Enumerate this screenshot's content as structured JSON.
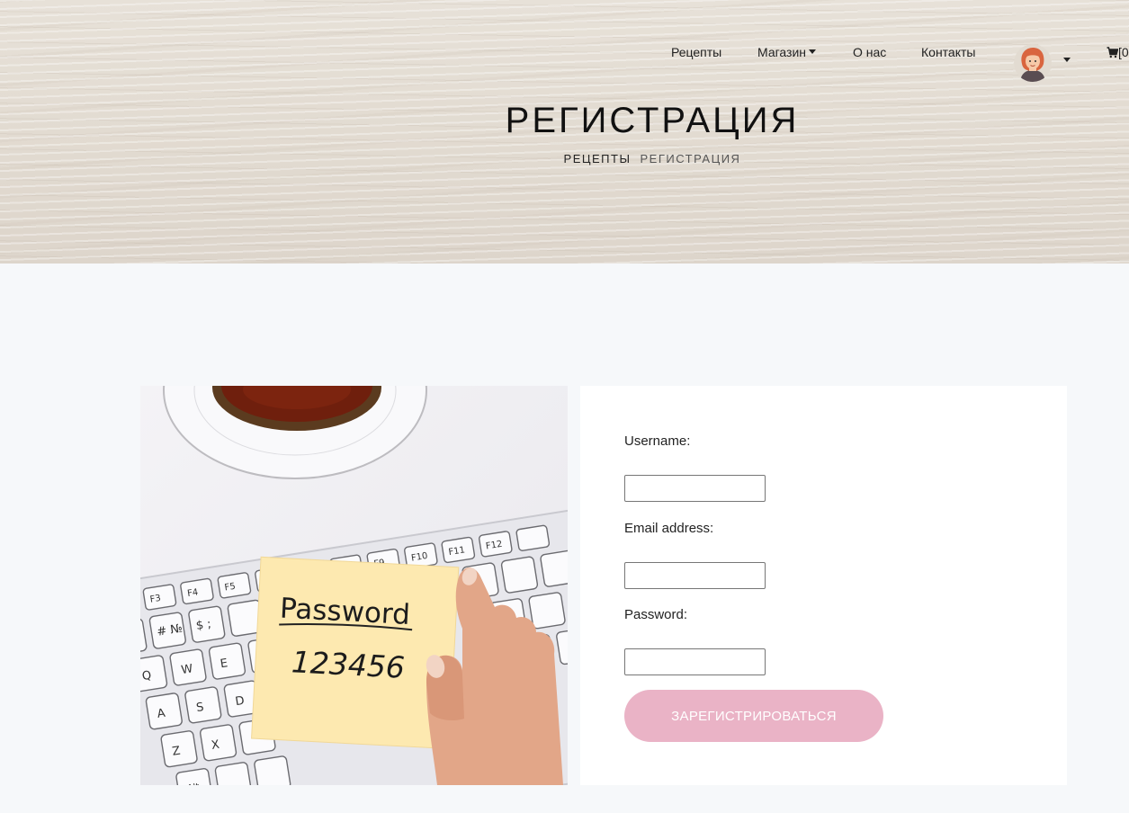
{
  "nav": {
    "items": [
      {
        "label": "Рецепты"
      },
      {
        "label": "Магазин"
      },
      {
        "label": "О нас"
      },
      {
        "label": "Контакты"
      }
    ],
    "cart_label": "[0"
  },
  "hero": {
    "title": "РЕГИСТРАЦИЯ",
    "breadcrumb": {
      "link": "РЕЦЕПТЫ",
      "current": "РЕГИСТРАЦИЯ"
    }
  },
  "photo": {
    "note_line1": "Password",
    "note_line2": "123456"
  },
  "form": {
    "username_label": "Username:",
    "email_label": "Email address:",
    "password_label": "Password:",
    "username_value": "",
    "email_value": "",
    "password_value": "",
    "submit_label": "ЗАРЕГИСТРИРОВАТЬСЯ"
  },
  "colors": {
    "accent_button": "#eab3c6",
    "page_bg": "#f6f8fa"
  }
}
